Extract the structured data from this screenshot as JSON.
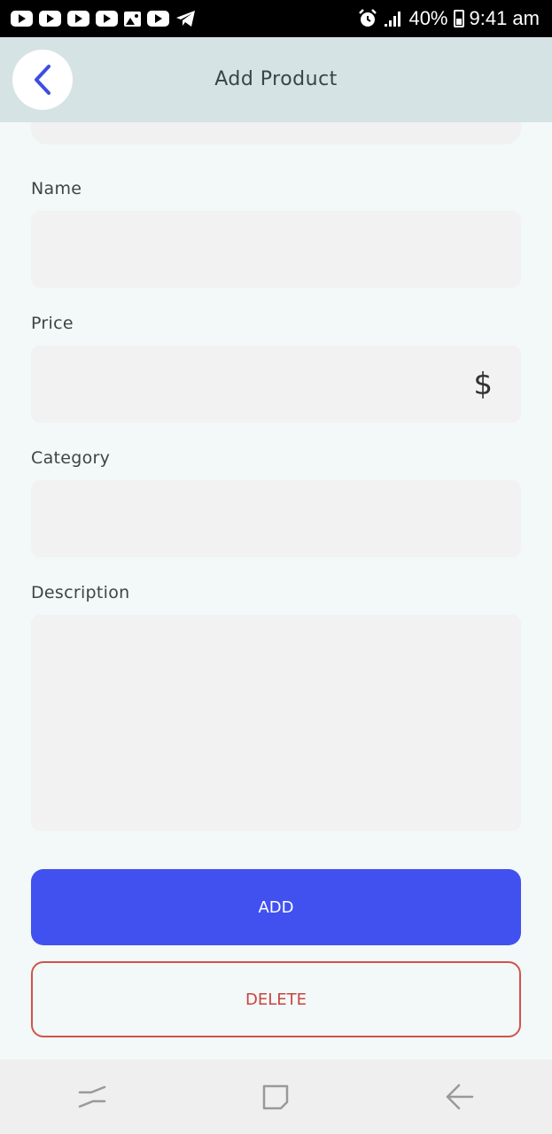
{
  "app": {
    "title": "Add  Product"
  },
  "status_bar": {
    "battery": "40%",
    "time": "9:41 am"
  },
  "form": {
    "name_label": "Name",
    "price_label": "Price",
    "price_symbol": "$",
    "category_label": "Category",
    "description_label": "Description",
    "name_value": "",
    "price_value": "",
    "category_value": "",
    "description_value": ""
  },
  "actions": {
    "add_label": "ADD",
    "delete_label": "DELETE"
  },
  "colors": {
    "accent": "#4151f0",
    "danger": "#d0544c",
    "appbar": "#d6e3e4"
  }
}
